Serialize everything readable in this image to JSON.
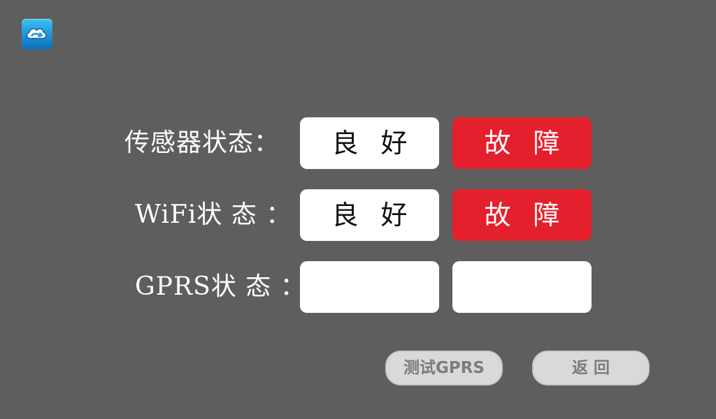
{
  "app": {
    "icon_name": "cloud-icon",
    "icon_colors": [
      "#3ec1f4",
      "#0f6db7"
    ]
  },
  "colors": {
    "background": "#5f5d5e",
    "good_box": "#ffffff",
    "fault_box": "#e5202d",
    "button": "#d9d9d9",
    "button_text": "#7c7c7c"
  },
  "rows": [
    {
      "label": "传感器状态：",
      "good_label": "良 好",
      "fault_label": "故 障"
    },
    {
      "label": "WiFi状 态 ：",
      "good_label": "良 好",
      "fault_label": "故 障"
    },
    {
      "label": "GPRS状 态 ：",
      "good_label": "",
      "fault_label": ""
    }
  ],
  "buttons": {
    "test_gprs": "测试GPRS",
    "back": "返 回"
  }
}
